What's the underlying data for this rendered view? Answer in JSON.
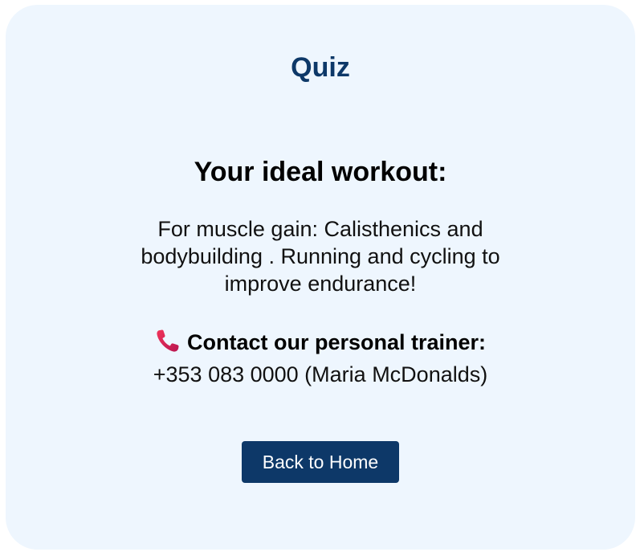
{
  "page": {
    "title": "Quiz"
  },
  "result": {
    "heading": "Your ideal workout:",
    "text": "For muscle gain: Calisthenics and bodybuilding . Running and cycling to improve endurance!"
  },
  "contact": {
    "icon": "telephone-receiver-icon",
    "label": "Contact our personal trainer:",
    "phone": "+353 083 0000 (Maria McDonalds)"
  },
  "actions": {
    "back_label": "Back to Home"
  },
  "colors": {
    "card_background": "#eef6fe",
    "title": "#0d3868",
    "button_background": "#0d3868",
    "button_text": "#ffffff",
    "phone_icon": "#e2264d"
  }
}
